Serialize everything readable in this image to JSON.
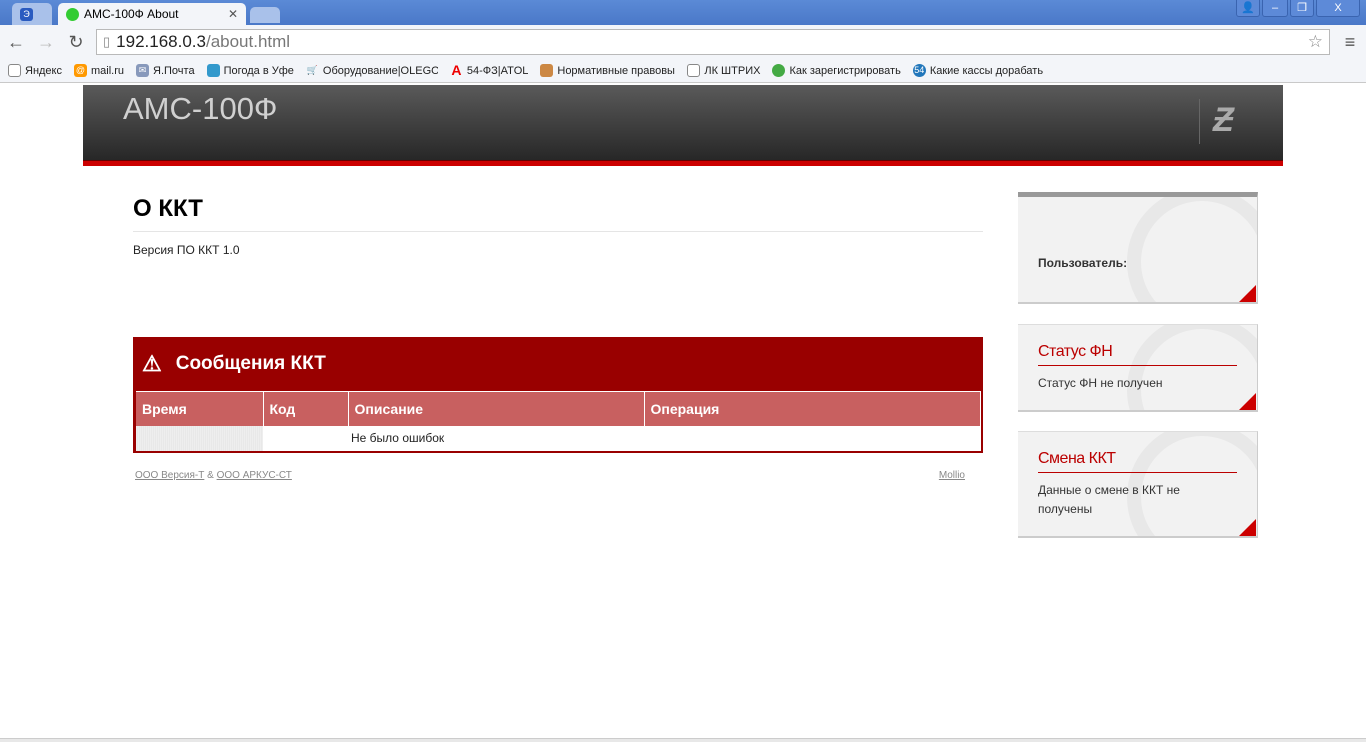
{
  "browser": {
    "tabs": [
      {
        "label": "АМС-100Ф About"
      }
    ],
    "url_host": "192.168.0.3",
    "url_path": "/about.html",
    "bookmarks": [
      {
        "label": "Яндекс"
      },
      {
        "label": "mail.ru"
      },
      {
        "label": "Я.Почта"
      },
      {
        "label": "Погода в Уфе"
      },
      {
        "label": "Оборудование|OLEGON"
      },
      {
        "label": "54-ФЗ|ATOL"
      },
      {
        "label": "Нормативные правовы"
      },
      {
        "label": "ЛК ШТРИХ"
      },
      {
        "label": "Как зарегистрировать"
      },
      {
        "label": "Какие кассы дорабать"
      }
    ]
  },
  "header": {
    "title": "АМС-100Ф"
  },
  "page": {
    "heading": "О ККТ",
    "version": "Версия ПО ККТ 1.0"
  },
  "messages": {
    "title": "Сообщения ККТ",
    "columns": [
      "Время",
      "Код",
      "Описание",
      "Операция"
    ],
    "rows": [
      {
        "time": "",
        "code": "",
        "description": "Не было ошибок",
        "operation": ""
      }
    ]
  },
  "footer": {
    "link1": "ООО Версия-Т",
    "amp": "&",
    "link2": "ООО АРКУС-СТ",
    "right": "Mollio"
  },
  "sidebar": {
    "user_label": "Пользователь:",
    "fn_title": "Статус ФН",
    "fn_text": "Статус ФН не получен",
    "shift_title": "Смена ККТ",
    "shift_text": "Данные о смене в ККТ не получены"
  },
  "colors": {
    "accent": "#990000",
    "red": "#cc0000"
  }
}
